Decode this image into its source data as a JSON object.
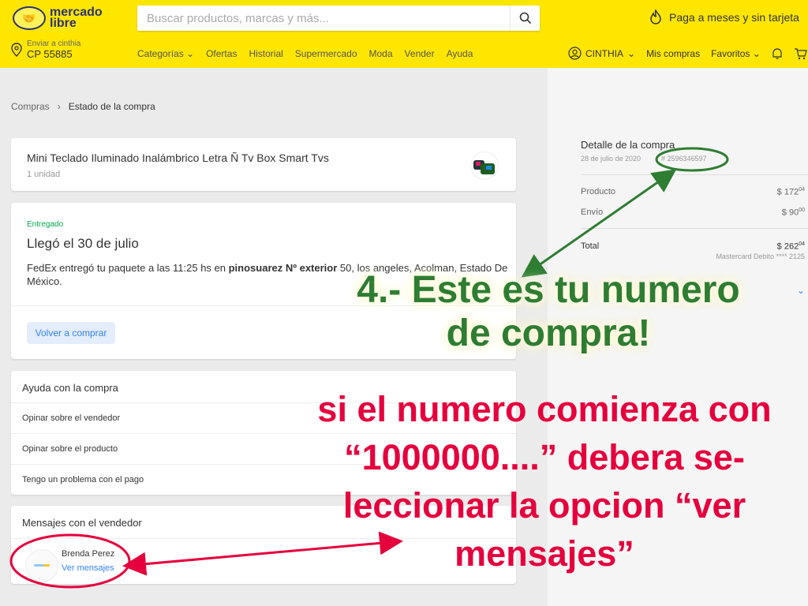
{
  "header": {
    "logo_text": "mercado libre",
    "search_placeholder": "Buscar productos, marcas y más...",
    "promo": "Paga a meses y sin tarjeta",
    "address_label": "Enviar a cinthia",
    "address_cp": "CP 55885",
    "nav": [
      "Categorías",
      "Ofertas",
      "Historial",
      "Supermercado",
      "Moda",
      "Vender",
      "Ayuda"
    ],
    "user": "CINTHIA",
    "mis_compras": "Mis compras",
    "favoritos": "Favoritos"
  },
  "breadcrumb": {
    "root": "Compras",
    "current": "Estado de la compra"
  },
  "product": {
    "title": "Mini Teclado Iluminado Inalámbrico Letra Ñ Tv Box Smart Tvs",
    "units": "1 unidad"
  },
  "shipment": {
    "status": "Entregado",
    "headline": "Llegó el 30 de julio",
    "desc_prefix": "FedEx entregó tu paquete a las 11:25 hs en ",
    "desc_bold": "pinosuarez Nº exterior",
    "desc_rest": " 50, los angeles, Acolman, Estado De México.",
    "rebuy": "Volver a comprar"
  },
  "help": {
    "title": "Ayuda con la compra",
    "items": [
      "Opinar sobre el vendedor",
      "Opinar sobre el producto",
      "Tengo un problema con el pago"
    ]
  },
  "messages": {
    "title": "Mensajes con el vendedor",
    "seller": "Brenda Perez",
    "link": "Ver mensajes"
  },
  "detail": {
    "title": "Detalle de la compra",
    "date": "28 de julio de 2020",
    "number": "# 2596346597",
    "rows": [
      {
        "label": "Producto",
        "value": "$ 172",
        "cents": "04"
      },
      {
        "label": "Envío",
        "value": "$ 90",
        "cents": "00"
      }
    ],
    "total_label": "Total",
    "total_value": "$ 262",
    "total_cents": "04",
    "payment": "Mastercard Debito **** 2125"
  },
  "annotations": {
    "green_1": "4.- Este es tu numero",
    "green_2": "de compra!",
    "red_1": "si el numero comienza con",
    "red_2": "“1000000....” debera se-",
    "red_3": "leccionar la opcion “ver",
    "red_4": "mensajes”"
  },
  "colors": {
    "header": "#ffe600",
    "accent": "#3483fa",
    "success": "#00a650",
    "annotation_green": "#2e7d32",
    "annotation_red": "#e5003d"
  }
}
